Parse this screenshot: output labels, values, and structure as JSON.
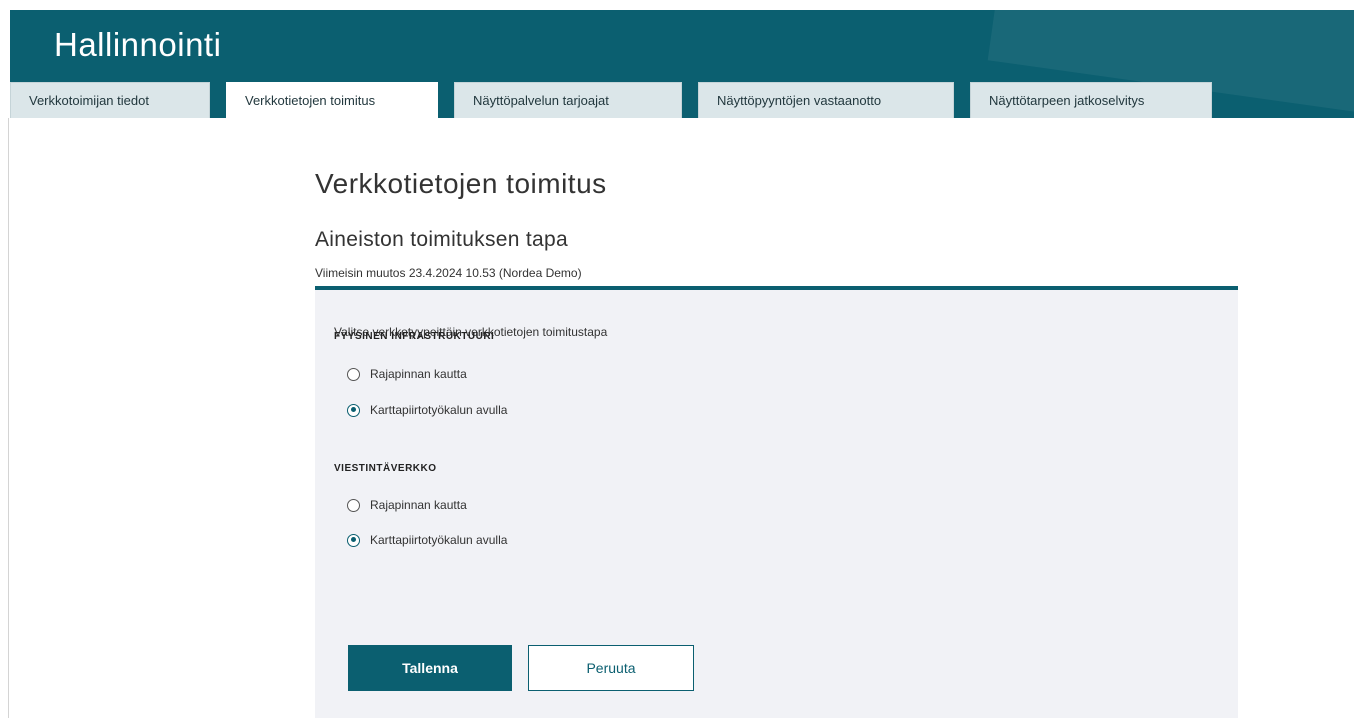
{
  "header": {
    "title": "Hallinnointi"
  },
  "tabs": [
    {
      "label": "Verkkotoimijan tiedot",
      "active": false
    },
    {
      "label": "Verkkotietojen toimitus",
      "active": true
    },
    {
      "label": "Näyttöpalvelun tarjoajat",
      "active": false
    },
    {
      "label": "Näyttöpyyntöjen vastaanotto",
      "active": false
    },
    {
      "label": "Näyttötarpeen jatkoselvitys",
      "active": false
    }
  ],
  "main": {
    "page_title": "Verkkotietojen toimitus",
    "section_title": "Aineiston toimituksen tapa",
    "last_modified": "Viimeisin muutos 23.4.2024 10.53 (Nordea Demo)",
    "instructions": "Valitse verkkotyypeittäin verkkotietojen toimitustapa",
    "groups": [
      {
        "label": "FYYSINEN INFRASTRUKTUURI",
        "options": [
          {
            "label": "Rajapinnan kautta",
            "selected": false
          },
          {
            "label": "Karttapiirtotyökalun avulla",
            "selected": true
          }
        ]
      },
      {
        "label": "VIESTINTÄVERKKO",
        "options": [
          {
            "label": "Rajapinnan kautta",
            "selected": false
          },
          {
            "label": "Karttapiirtotyökalun avulla",
            "selected": true
          }
        ]
      }
    ],
    "buttons": {
      "save_label": "Tallenna",
      "cancel_label": "Peruuta"
    }
  },
  "colors": {
    "primary": "#0b5f70",
    "panel_background": "#f1f2f6",
    "tab_background": "#dbe6e9"
  }
}
